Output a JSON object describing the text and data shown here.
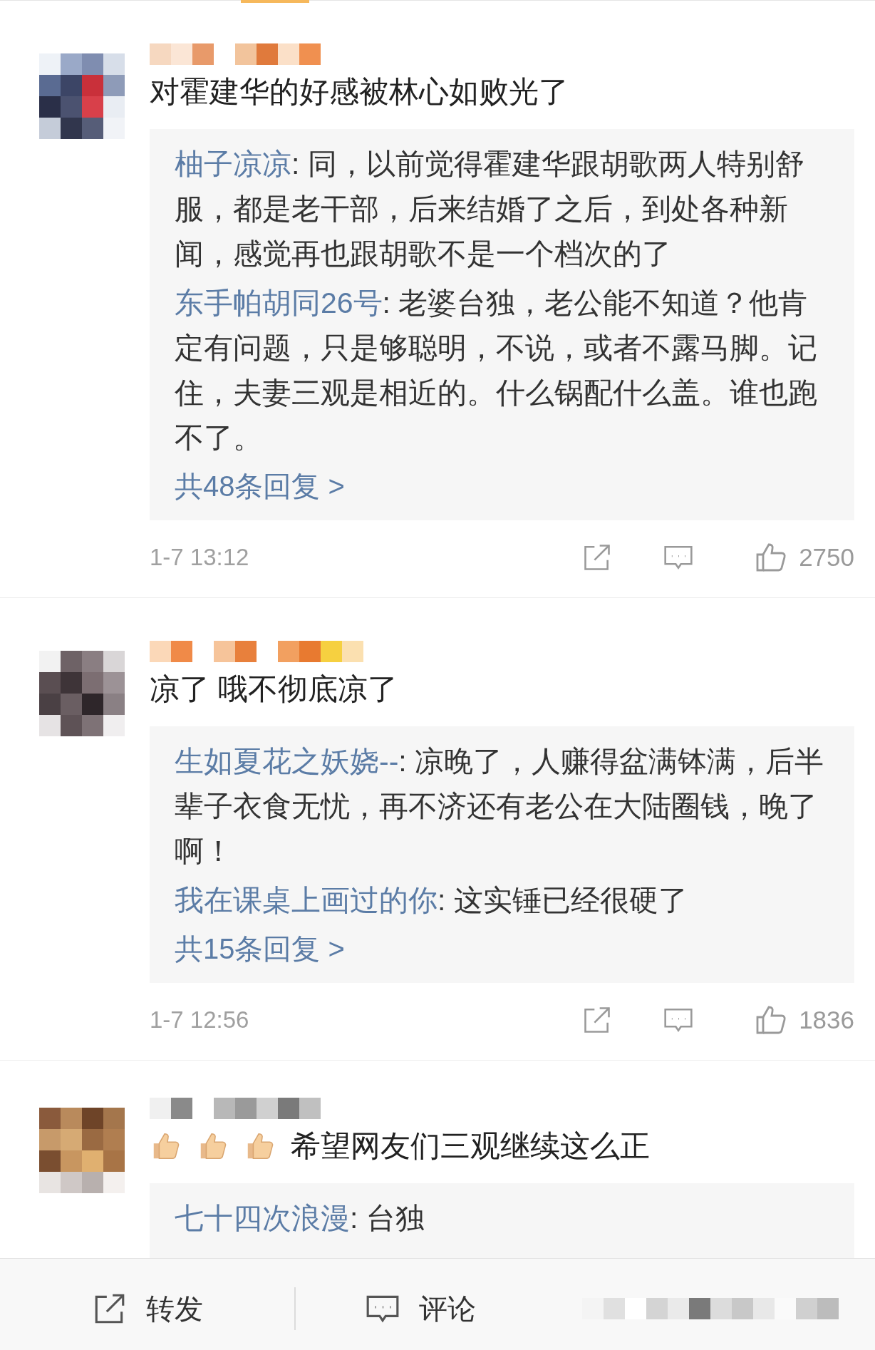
{
  "comments": [
    {
      "kind": "plain",
      "text": "对霍建华的好感被林心如败光了",
      "replies": [
        {
          "author": "柚子凉凉",
          "text": ": 同，以前觉得霍建华跟胡歌两人特别舒服，都是老干部，后来结婚了之后，到处各种新闻，感觉再也跟胡歌不是一个档次的了"
        },
        {
          "author": "东手帕胡同26号",
          "text": ": 老婆台独，老公能不知道？他肯定有问题，只是够聪明，不说，或者不露马脚。记住，夫妻三观是相近的。什么锅配什么盖。谁也跑不了。"
        }
      ],
      "more": "共48条回复 >",
      "time": "1-7 13:12",
      "likes": "2750"
    },
    {
      "kind": "plain",
      "text": "凉了 哦不彻底凉了",
      "replies": [
        {
          "author": "生如夏花之妖娆--",
          "text": ": 凉晚了，人赚得盆满钵满，后半辈子衣食无忧，再不济还有老公在大陆圈钱，晚了啊！"
        },
        {
          "author": "我在课桌上画过的你",
          "text": ": 这实锤已经很硬了"
        }
      ],
      "more": "共15条回复 >",
      "time": "1-7 12:56",
      "likes": "1836"
    },
    {
      "kind": "thumbs",
      "text": "希望网友们三观继续这么正",
      "replies": [
        {
          "author": "七十四次浪漫",
          "text": ": 台独"
        }
      ]
    }
  ],
  "bottom_bar": {
    "actions": [
      {
        "kind": "repost",
        "label": "转发"
      },
      {
        "kind": "comment",
        "label": "评论"
      }
    ]
  }
}
